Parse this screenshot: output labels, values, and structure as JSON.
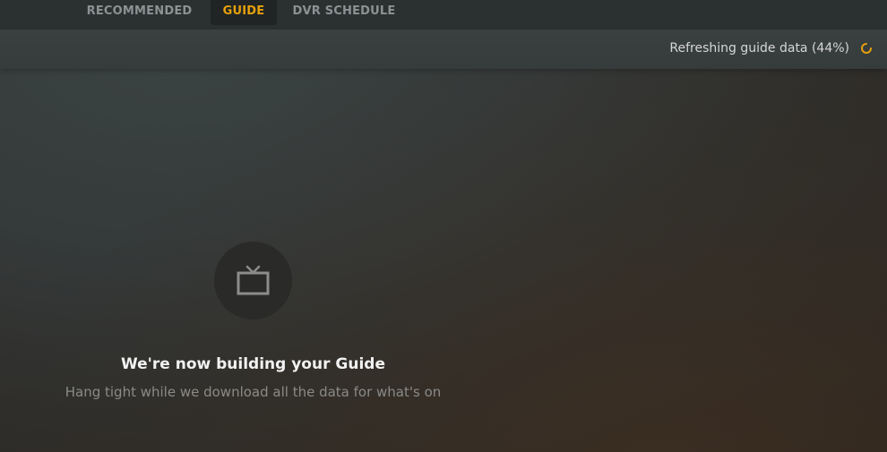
{
  "nav": {
    "tabs": [
      {
        "label": "RECOMMENDED",
        "active": false
      },
      {
        "label": "GUIDE",
        "active": true
      },
      {
        "label": "DVR SCHEDULE",
        "active": false
      }
    ]
  },
  "status": {
    "text": "Refreshing guide data (44%)",
    "progress_percent": 44
  },
  "empty_state": {
    "icon": "tv-icon",
    "title": "We're now building your Guide",
    "subtitle": "Hang tight while we download all the data for what's on"
  },
  "colors": {
    "accent": "#e5a00d",
    "tab_inactive": "#8e9193",
    "background": "#353a3a"
  }
}
